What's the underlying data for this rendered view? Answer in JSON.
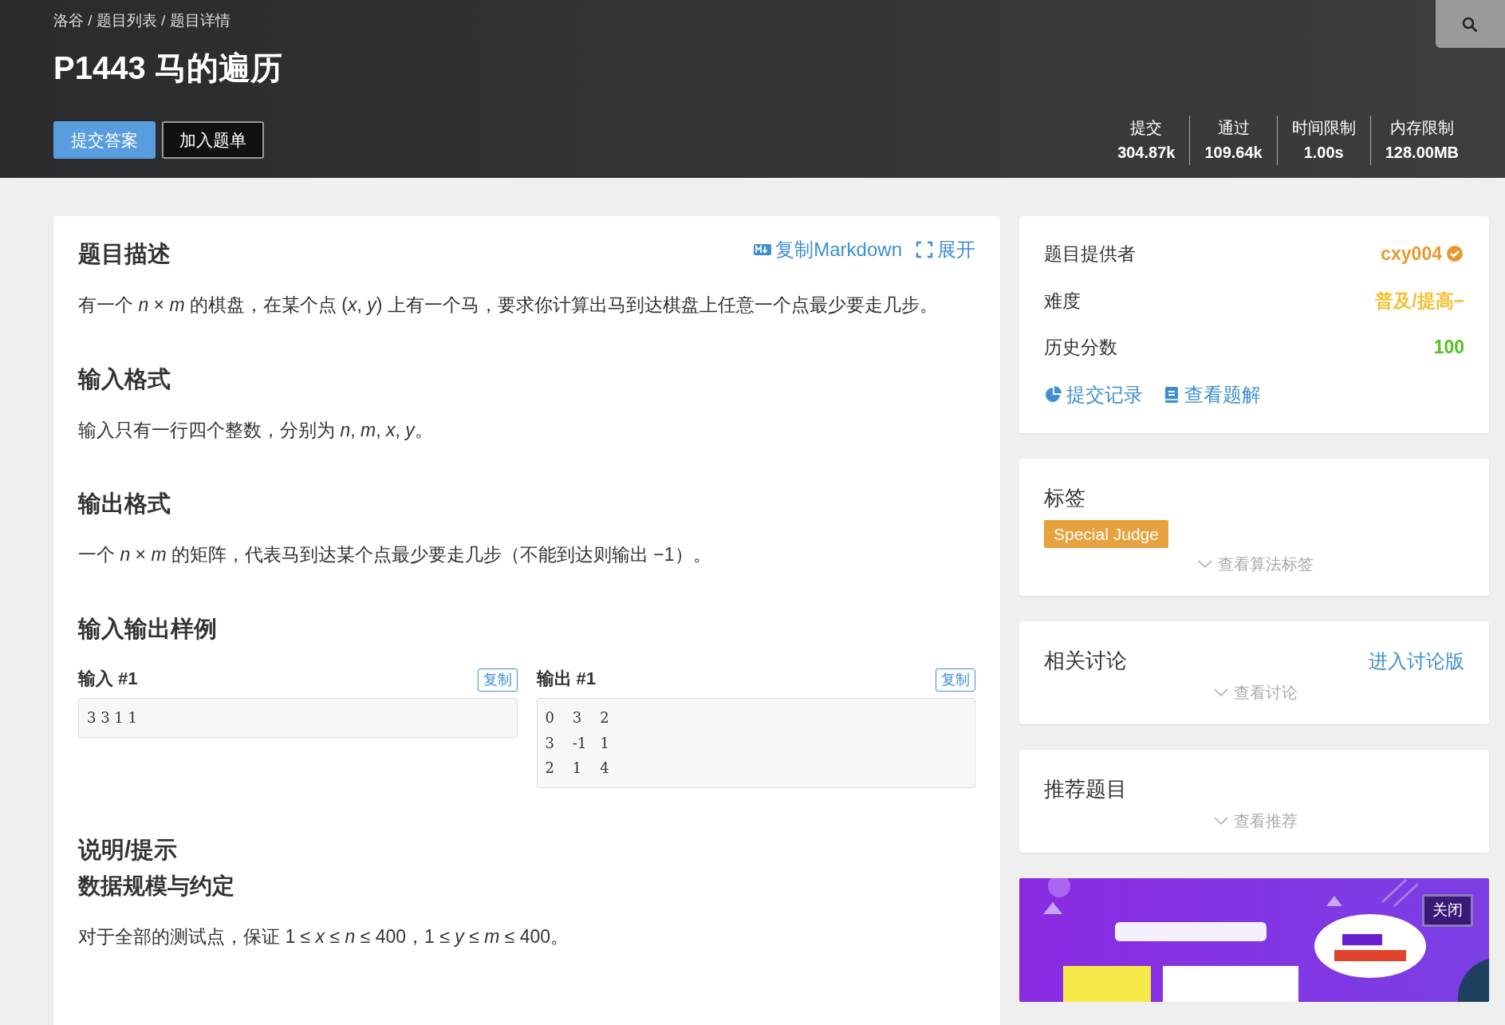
{
  "breadcrumb": "洛谷 / 题目列表 / 题目详情",
  "title": "P1443 马的遍历",
  "actions": [
    {
      "label": "提交答案",
      "kind": "primary"
    },
    {
      "label": "加入题单",
      "kind": "outline"
    }
  ],
  "stats": [
    {
      "label": "提交",
      "value": "304.87k"
    },
    {
      "label": "通过",
      "value": "109.64k"
    },
    {
      "label": "时间限制",
      "value": "1.00s"
    },
    {
      "label": "内存限制",
      "value": "128.00MB"
    }
  ],
  "problem": {
    "tools": [
      {
        "label": "复制Markdown",
        "kind": "markdown"
      },
      {
        "label": "展开",
        "kind": "expand"
      }
    ],
    "sections": [
      {
        "kind": "heading",
        "text": "题目描述"
      },
      {
        "kind": "paragraph",
        "text": "有一个 *n* × *m* 的棋盘，在某个点 (*x*, *y*) 上有一个马，要求你计算出马到达棋盘上任意一个点最少要走几步。"
      },
      {
        "kind": "heading",
        "text": "输入格式"
      },
      {
        "kind": "paragraph",
        "text": "输入只有一行四个整数，分别为 *n*, *m*, *x*, *y*。"
      },
      {
        "kind": "heading",
        "text": "输出格式"
      },
      {
        "kind": "paragraph",
        "text": "一个 *n* × *m* 的矩阵，代表马到达某个点最少要走几步（不能到达则输出 −1）。"
      },
      {
        "kind": "heading",
        "text": "输入输出样例"
      },
      {
        "kind": "samples",
        "items": [
          {
            "label": "输入 #1",
            "copy": "复制",
            "lines": [
              "3 3 1 1"
            ]
          },
          {
            "label": "输出 #1",
            "copy": "复制",
            "lines": [
              "0    3    2",
              "3    -1   1",
              "2    1    4"
            ]
          }
        ]
      },
      {
        "kind": "heading",
        "text": "说明/提示"
      },
      {
        "kind": "subheading",
        "text": "数据规模与约定"
      },
      {
        "kind": "paragraph",
        "text": "对于全部的测试点，保证 1 ≤ *x* ≤ *n* ≤ 400，1 ≤ *y* ≤ *m* ≤ 400。"
      }
    ]
  },
  "info": {
    "rows": [
      {
        "label": "题目提供者",
        "value": "cxy004",
        "kind": "user",
        "color": "#e69a2e"
      },
      {
        "label": "难度",
        "value": "普及/提高−",
        "kind": "text",
        "color": "#f3c033"
      },
      {
        "label": "历史分数",
        "value": "100",
        "kind": "text",
        "color": "#52c41a"
      }
    ],
    "links": [
      {
        "label": "提交记录",
        "kind": "chart"
      },
      {
        "label": "查看题解",
        "kind": "book"
      }
    ]
  },
  "tags": {
    "title": "标签",
    "items": [
      {
        "label": "Special Judge",
        "color": "#e6a23c"
      }
    ],
    "toggle": "查看算法标签"
  },
  "discussion": {
    "title": "相关讨论",
    "link": "进入讨论版",
    "toggle": "查看讨论"
  },
  "recommend": {
    "title": "推荐题目",
    "toggle": "查看推荐"
  },
  "ad": {
    "kind": "picture",
    "close": "关闭"
  }
}
